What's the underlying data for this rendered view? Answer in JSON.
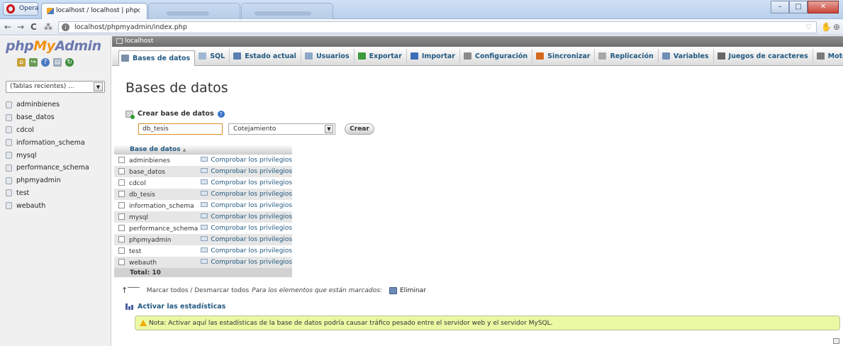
{
  "browser": {
    "menu_label": "Opera",
    "tab_title": "localhost / localhost | php",
    "tab_close": "×",
    "url": "localhost/phpmyadmin/index.php",
    "nav": {
      "back": "←",
      "forward": "→",
      "reload": "C",
      "speed_dial": "⁂"
    },
    "window_buttons": {
      "minimize": "–",
      "maximize": "□",
      "close": "✕"
    }
  },
  "sidebar": {
    "logo": {
      "php": "php",
      "my": "My",
      "admin": "Admin"
    },
    "recent_select": "(Tablas recientes) ...",
    "databases": [
      "adminbienes",
      "base_datos",
      "cdcol",
      "information_schema",
      "mysql",
      "performance_schema",
      "phpmyadmin",
      "test",
      "webauth"
    ]
  },
  "server_bar": {
    "label": "localhost"
  },
  "menu": {
    "tabs": [
      {
        "label": "Bases de datos",
        "color": "#7a8fa8"
      },
      {
        "label": "SQL",
        "color": "#9fb7d4"
      },
      {
        "label": "Estado actual",
        "color": "#5a7fb0"
      },
      {
        "label": "Usuarios",
        "color": "#8ea7c7"
      },
      {
        "label": "Exportar",
        "color": "#3c9a3c"
      },
      {
        "label": "Importar",
        "color": "#3c6fb8"
      },
      {
        "label": "Configuración",
        "color": "#8b8b8b"
      },
      {
        "label": "Sincronizar",
        "color": "#d46a1e"
      },
      {
        "label": "Replicación",
        "color": "#a8a8a8"
      },
      {
        "label": "Variables",
        "color": "#6f8fb6"
      },
      {
        "label": "Juegos de caracteres",
        "color": "#666666"
      },
      {
        "label": "Motores",
        "color": "#7b7b7b"
      }
    ]
  },
  "main": {
    "title": "Bases de datos",
    "create": {
      "label": "Crear base de datos",
      "name_value": "db_tesis",
      "collation": "Cotejamiento",
      "button": "Crear"
    },
    "table": {
      "header": "Base de datos",
      "sort_arrow": "▲",
      "priv_link": "Comprobar los privilegios",
      "rows": [
        "adminbienes",
        "base_datos",
        "cdcol",
        "db_tesis",
        "information_schema",
        "mysql",
        "performance_schema",
        "phpmyadmin",
        "test",
        "webauth"
      ],
      "total": "Total: 10"
    },
    "mark": {
      "check_all": "Marcar todos",
      "separator": " / ",
      "uncheck_all": "Desmarcar todos",
      "note": "Para los elementos que están marcados:",
      "delete": "Eliminar"
    },
    "stats_link": "Activar las estadísticas",
    "notice": "Nota: Activar aquí las estadísticas de la base de datos podría causar tráfico pesado entre el servidor web y el servidor MySQL."
  }
}
